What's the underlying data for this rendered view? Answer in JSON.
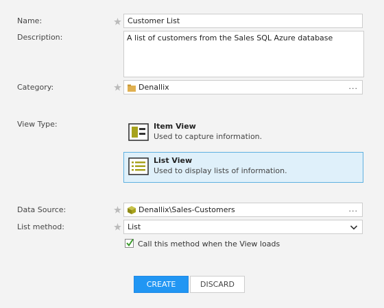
{
  "form": {
    "name": {
      "label": "Name:",
      "value": "Customer List"
    },
    "description": {
      "label": "Description:",
      "value": "A list of customers from the Sales SQL Azure database"
    },
    "category": {
      "label": "Category:",
      "value": "Denallix",
      "icon": "folder-icon",
      "ellipsis": "..."
    },
    "view_type": {
      "label": "View Type:",
      "options": [
        {
          "title": "Item View",
          "description": "Used to capture information.",
          "icon": "item-view-icon",
          "selected": false
        },
        {
          "title": "List View",
          "description": "Used to display lists of information.",
          "icon": "list-view-icon",
          "selected": true
        }
      ]
    },
    "data_source": {
      "label": "Data Source:",
      "value": "Denallix\\Sales-Customers",
      "icon": "smartobject-cube-icon",
      "ellipsis": "..."
    },
    "list_method": {
      "label": "List method:",
      "value": "List",
      "icon": "chevron-down-icon"
    },
    "call_on_load": {
      "label": "Call this method when the View loads",
      "checked": true
    }
  },
  "buttons": {
    "create": "CREATE",
    "discard": "DISCARD"
  },
  "colors": {
    "accent": "#2196f3",
    "selected_bg": "#dff0fa",
    "selected_border": "#5db0e0",
    "icon_olive": "#a7a21c"
  }
}
